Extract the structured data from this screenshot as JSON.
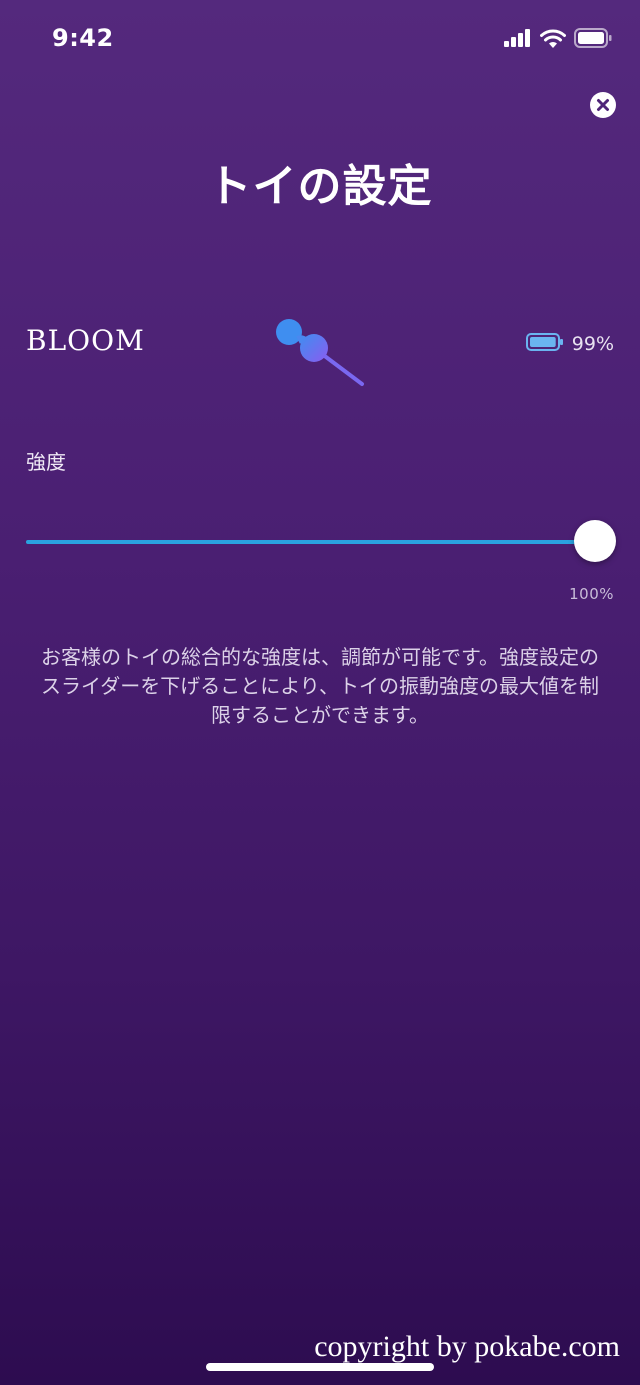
{
  "status_bar": {
    "time": "9:42",
    "icons": [
      "signal-icon",
      "wifi-icon",
      "battery-icon"
    ]
  },
  "header": {
    "title": "トイの設定",
    "close_icon": "close-icon"
  },
  "toy": {
    "name": "BLOOM",
    "image_icon": "kegel-balls-icon",
    "battery_icon": "battery-icon",
    "battery_percent": "99%",
    "battery_level": 0.99
  },
  "intensity": {
    "label": "強度",
    "value_text": "100%",
    "value_fraction": 1.0
  },
  "description": "お客様のトイの総合的な強度は、調節が可能です。強度設定のスライダーを下げることにより、トイの振動強度の最大値を制限することができます。",
  "watermark": "copyright by pokabe.com",
  "colors": {
    "background_top": "#54297d",
    "background_bottom": "#2d0c50",
    "slider_track": "#2aa2e0",
    "battery_fill": "#6ab4f0",
    "toy_gradient_start": "#3f8ef0",
    "toy_gradient_end": "#8a5cf0"
  }
}
